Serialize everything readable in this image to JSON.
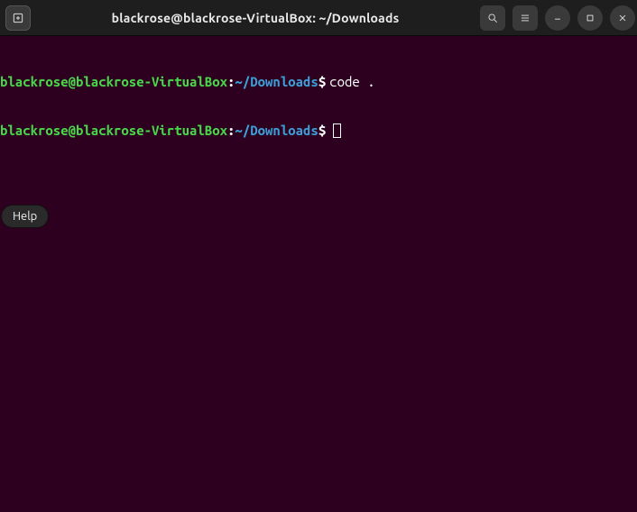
{
  "window_title": "blackrose@blackrose-VirtualBox: ~/Downloads",
  "prompt": {
    "user_host": "blackrose@blackrose-VirtualBox",
    "separator": ":",
    "cwd": "~/Downloads",
    "symbol": "$"
  },
  "lines": [
    {
      "command": "code ."
    },
    {
      "command": ""
    }
  ],
  "tooltip": "Help"
}
